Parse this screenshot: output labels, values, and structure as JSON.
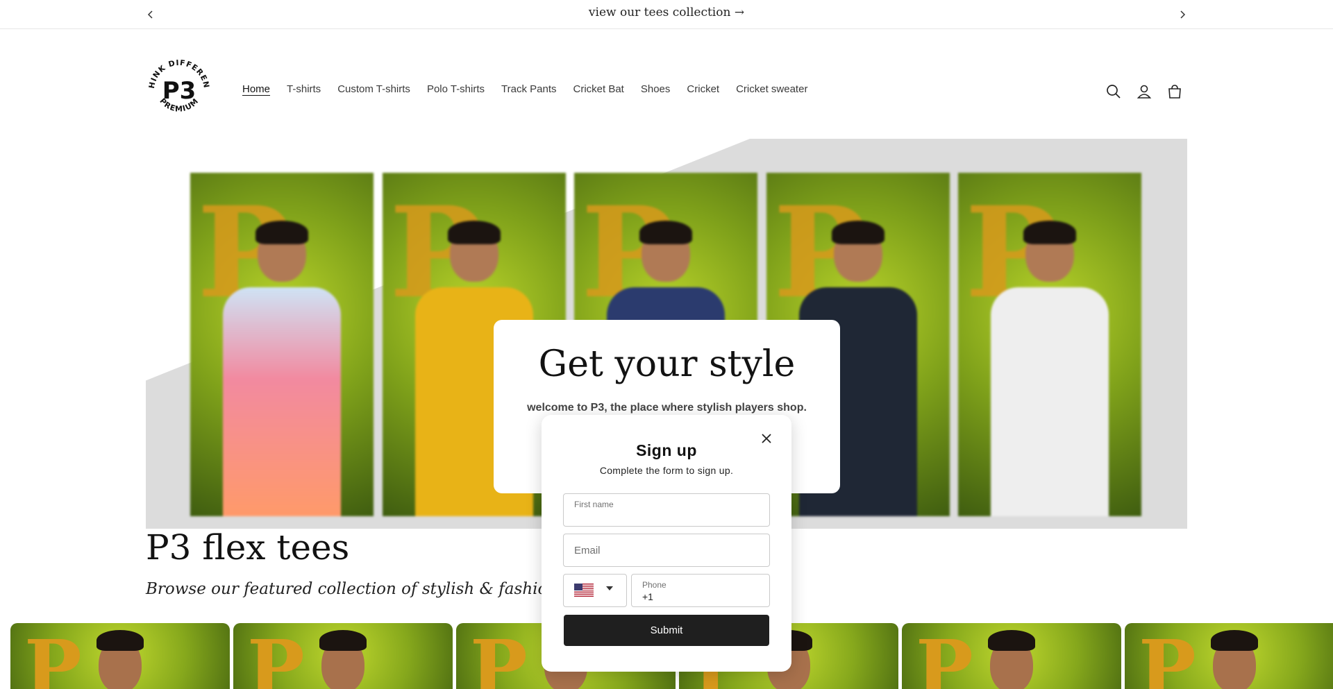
{
  "announcement": {
    "message": "view our tees collection →",
    "prev_icon": "chevron-left-icon",
    "next_icon": "chevron-right-icon"
  },
  "header": {
    "logo": {
      "ring_text_top": "THINK DIFFERENT",
      "ring_text_bottom": "PREMIUM",
      "mark": "P3"
    },
    "nav": [
      {
        "label": "Home",
        "active": true
      },
      {
        "label": "T-shirts"
      },
      {
        "label": "Custom T-shirts"
      },
      {
        "label": "Polo T-shirts"
      },
      {
        "label": "Track Pants"
      },
      {
        "label": "Cricket Bat"
      },
      {
        "label": "Shoes"
      },
      {
        "label": "Cricket"
      },
      {
        "label": "Cricket sweater"
      }
    ],
    "icons": [
      "search-icon",
      "account-icon",
      "cart-icon"
    ]
  },
  "hero": {
    "title": "Get your style",
    "subtitle": "welcome to P3, the place where stylish players shop."
  },
  "collection": {
    "title": "P3 flex tees",
    "subtitle": "Browse our featured collection of stylish & fashionable t"
  },
  "signup_modal": {
    "title": "Sign up",
    "subtitle": "Complete the form to sign up.",
    "first_name_label": "First name",
    "email_placeholder": "Email",
    "phone_label": "Phone",
    "phone_value": "+1",
    "country_flag": "us-flag-icon",
    "submit_label": "Submit"
  },
  "colors": {
    "accent_dark": "#1f1f1f",
    "hero_panel_bg": "#dcdcdc",
    "brand_orange": "#d89a1c",
    "foliage_green": "#86a81c"
  }
}
